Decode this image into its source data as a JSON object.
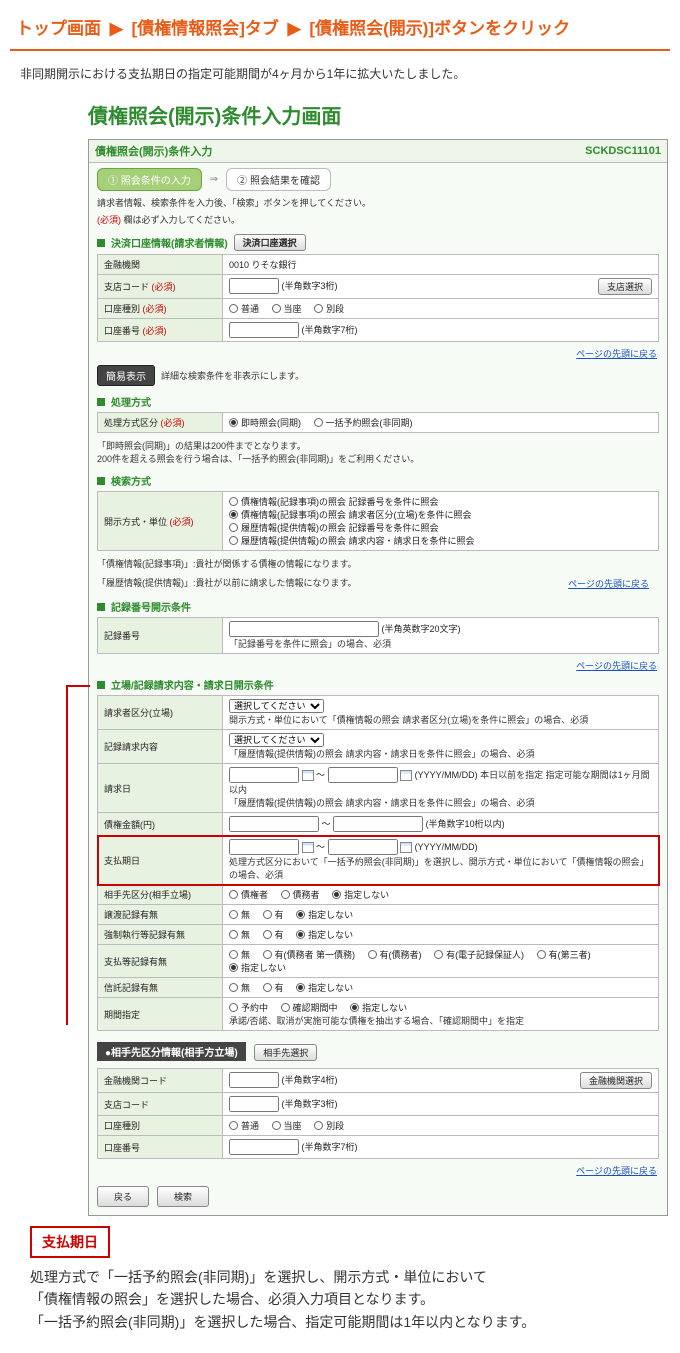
{
  "header": {
    "path1": "トップ画面",
    "path2": "[債権情報照会]タブ",
    "path3": "[債権照会(開示)]ボタンをクリック"
  },
  "lead": "非同期開示における支払期日の指定可能期間が4ヶ月から1年に拡大いたしました。",
  "screen_title": "債権照会(開示)条件入力画面",
  "shot": {
    "title": "債権照会(開示)条件入力",
    "code": "SCKDSC11101",
    "step1": "① 照会条件の入力",
    "step2": "② 照会結果を確認",
    "arrow": "⇒",
    "intro": "請求者情報、検索条件を入力後、「検索」ボタンを押してください。",
    "must_prefix": "(必須)",
    "must_note": "欄は必ず入力してください。",
    "sect_account": "決済口座情報(請求者情報)",
    "btn_account_sel": "決済口座選択",
    "labels": {
      "bank": "金融機関",
      "branch_code": "支店コード",
      "acct_type": "口座種別",
      "acct_no": "口座番号"
    },
    "branch_btn": "支店選択",
    "bank_val": "0010 りそな銀行",
    "branch_note": "(半角数字3桁)",
    "acct_opts": {
      "futsu": "普通",
      "touza": "当座",
      "betsu": "別段"
    },
    "acct_no_note": "(半角数字7桁)",
    "page_top": "ページの先頭に戻る",
    "simple_btn": "簡易表示",
    "simple_note": "詳細な検索条件を非表示にします。",
    "sect_proc": "処理方式",
    "proc_label": "処理方式区分",
    "proc_opt1": "即時照会(同期)",
    "proc_opt2": "一括予約照会(非同期)",
    "proc_note": "「即時照会(同期)」の結果は200件までとなります。\n200件を超える照会を行う場合は、「一括予約照会(非同期)」をご利用ください。",
    "sect_search": "検索方式",
    "search_label": "開示方式・単位",
    "search_opts": [
      "債権情報(記録事項)の照会 記録番号を条件に照会",
      "債権情報(記録事項)の照会 請求者区分(立場)を条件に照会",
      "履歴情報(提供情報)の照会 記録番号を条件に照会",
      "履歴情報(提供情報)の照会 請求内容・請求日を条件に照会"
    ],
    "search_note1": "「債権情報(記録事項)」:貴社が関係する債権の情報になります。",
    "search_note2": "「履歴情報(提供情報)」:貴社が以前に請求した情報になります。",
    "sect_recno": "記録番号開示条件",
    "recno_label": "記録番号",
    "recno_hint": "(半角英数字20文字)",
    "recno_note": "「記録番号を条件に照会」の場合、必須",
    "sect_position": "立場/記録請求内容・請求日開示条件",
    "pos_label": "請求者区分(立場)",
    "pos_select": "選択してください",
    "pos_note": "開示方式・単位において「債権情報の照会 請求者区分(立場)を条件に照会」の場合、必須",
    "reqcontent_label": "記録請求内容",
    "reqcontent_select": "選択してください",
    "reqcontent_note": "「履歴情報(提供情報)の照会 請求内容・請求日を条件に照会」の場合、必須",
    "reqdate_label": "請求日",
    "date_fmt": "(YYYY/MM/DD)",
    "reqdate_note": "本日以前を指定 指定可能な期間は1ヶ月間以内",
    "reqdate_note2": "「履歴情報(提供情報)の照会 請求内容・請求日を条件に照会」の場合、必須",
    "amount_label": "債権金額(円)",
    "amount_hint": "(半角数字10桁以内)",
    "paydate_label": "支払期日",
    "paydate_note": "処理方式区分において「一括予約照会(非同期)」を選択し、開示方式・単位において「債権情報の照会」の場合、必須",
    "opp_label": "相手先区分(相手立場)",
    "opp_opts": {
      "a": "債権者",
      "b": "債務者",
      "none": "指定しない"
    },
    "transfer_label": "譲渡記録有無",
    "yn": {
      "no": "無",
      "yes": "有",
      "none": "指定しない"
    },
    "force_label": "強制執行等記録有無",
    "trust_label": "信託記録有無",
    "s_label": "支払等記録有無",
    "s_opts": {
      "a": "無",
      "b": "有(債務者 第一債務)",
      "c": "有(債務者)",
      "d": "有(電子記録保証人)",
      "e": "有(第三者)",
      "none": "指定しない"
    },
    "period_label": "期間指定",
    "period_opts": {
      "a": "予約中",
      "b": "確認期間中",
      "none": "指定しない"
    },
    "period_note": "承諾/否諾、取消が実施可能な債権を抽出する場合、「確認期間中」を指定",
    "sect_opp": "相手先区分情報(相手方立場)",
    "opp_btn": "相手先選択",
    "opp_bankcode": "金融機関コード",
    "opp_bankcode_hint": "(半角数字4桁)",
    "opp_bankbtn": "金融機関選択",
    "opp_branchcode": "支店コード",
    "opp_branchcode_hint": "(半角数字3桁)",
    "opp_accttype": "口座種別",
    "opp_acctno": "口座番号",
    "opp_acctno_hint": "(半角数字7桁)",
    "page_top2": "ページの先頭に戻る",
    "btn_back": "戻る",
    "btn_search": "検索",
    "tilde": "～"
  },
  "callout": {
    "label": "支払期日",
    "text1": "処理方式で「一括予約照会(非同期)」を選択し、開示方式・単位において",
    "text2": "「債権情報の照会」を選択した場合、必須入力項目となります。",
    "text3": "「一括予約照会(非同期)」を選択した場合、指定可能期間は1年以内となります。"
  }
}
